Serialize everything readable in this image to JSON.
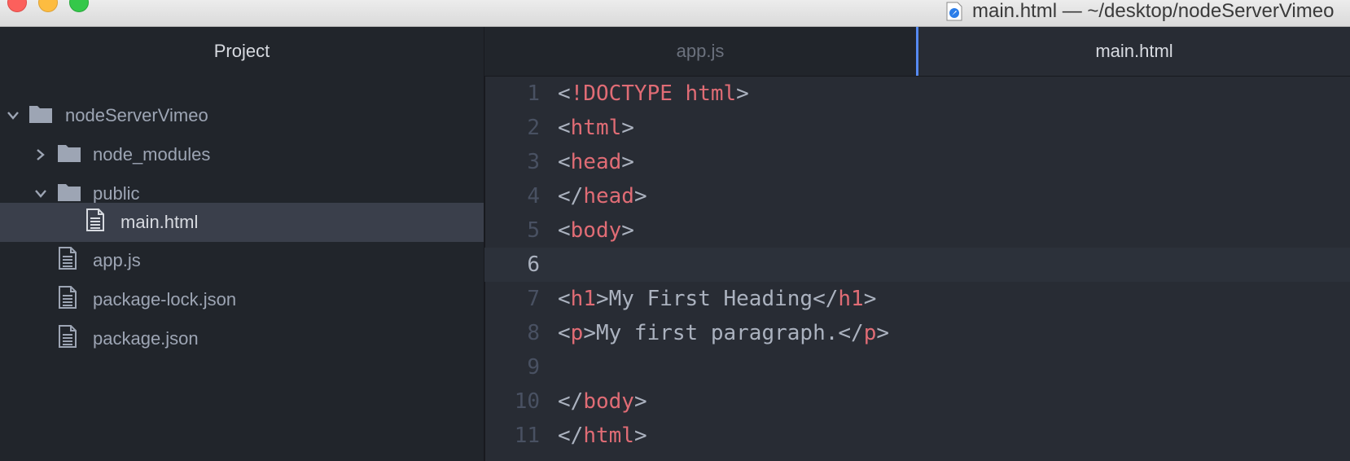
{
  "window": {
    "title": "main.html — ~/desktop/nodeServerVimeo"
  },
  "sidebar": {
    "header": "Project",
    "items": [
      {
        "label": "nodeServerVimeo",
        "type": "folder",
        "expanded": true
      },
      {
        "label": "node_modules",
        "type": "folder",
        "expanded": false
      },
      {
        "label": "public",
        "type": "folder",
        "expanded": true
      },
      {
        "label": "main.html",
        "type": "file",
        "selected": true
      },
      {
        "label": "app.js",
        "type": "file"
      },
      {
        "label": "package-lock.json",
        "type": "file"
      },
      {
        "label": "package.json",
        "type": "file"
      }
    ]
  },
  "tabs": [
    {
      "label": "app.js",
      "active": false
    },
    {
      "label": "main.html",
      "active": true
    }
  ],
  "editor": {
    "cursor_line": 6,
    "lines": [
      {
        "n": "1",
        "open": "<",
        "tag": "!DOCTYPE html",
        "close": ">",
        "text": "",
        "open2": "",
        "tag2": "",
        "close2": ""
      },
      {
        "n": "2",
        "open": "<",
        "tag": "html",
        "close": ">",
        "text": "",
        "open2": "",
        "tag2": "",
        "close2": ""
      },
      {
        "n": "3",
        "open": "<",
        "tag": "head",
        "close": ">",
        "text": "",
        "open2": "",
        "tag2": "",
        "close2": ""
      },
      {
        "n": "4",
        "open": "</",
        "tag": "head",
        "close": ">",
        "text": "",
        "open2": "",
        "tag2": "",
        "close2": ""
      },
      {
        "n": "5",
        "open": "<",
        "tag": "body",
        "close": ">",
        "text": "",
        "open2": "",
        "tag2": "",
        "close2": ""
      },
      {
        "n": "6",
        "open": "",
        "tag": "",
        "close": "",
        "text": "",
        "open2": "",
        "tag2": "",
        "close2": ""
      },
      {
        "n": "7",
        "open": "<",
        "tag": "h1",
        "close": ">",
        "text": "My First Heading",
        "open2": "</",
        "tag2": "h1",
        "close2": ">"
      },
      {
        "n": "8",
        "open": "<",
        "tag": "p",
        "close": ">",
        "text": "My first paragraph.",
        "open2": "</",
        "tag2": "p",
        "close2": ">"
      },
      {
        "n": "9",
        "open": "",
        "tag": "",
        "close": "",
        "text": "",
        "open2": "",
        "tag2": "",
        "close2": ""
      },
      {
        "n": "10",
        "open": "</",
        "tag": "body",
        "close": ">",
        "text": "",
        "open2": "",
        "tag2": "",
        "close2": ""
      },
      {
        "n": "11",
        "open": "</",
        "tag": "html",
        "close": ">",
        "text": "",
        "open2": "",
        "tag2": "",
        "close2": ""
      }
    ]
  },
  "colors": {
    "tag": "#e06c75",
    "text": "#abb2bf",
    "accent": "#568af2"
  }
}
